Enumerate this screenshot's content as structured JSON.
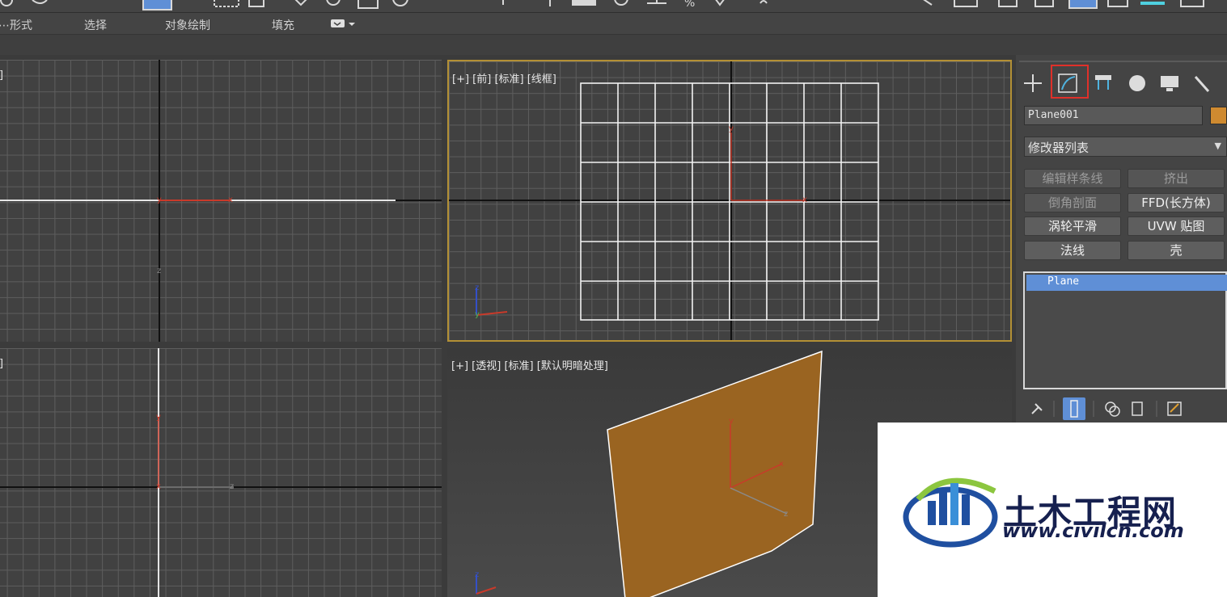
{
  "ribbon": {
    "items": [
      "多边形形式",
      "选择",
      "对象绘制",
      "填充"
    ],
    "shown": [
      "⋯形式",
      "选择",
      "对象绘制",
      "填充"
    ]
  },
  "viewports": {
    "top_left": {
      "label": "[+] [顶] [标准] [线框]",
      "visible_label": "]"
    },
    "top_right": {
      "label": "[+] [前] [标准] [线框]"
    },
    "bottom_left": {
      "label": "[+] [左] [标准] [线框]",
      "visible_label": "]"
    },
    "bottom_right": {
      "label": "[+] [透视] [标准] [默认明暗处理]"
    }
  },
  "panel": {
    "object_name": "Plane001",
    "object_color": "#cf8a30",
    "modifier_list": "修改器列表",
    "modifier_buttons": [
      "编辑样条线",
      "挤出",
      "倒角剖面",
      "FFD(长方体)",
      "涡轮平滑",
      "UVW 贴图",
      "法线",
      "壳"
    ],
    "stack": [
      "Plane"
    ],
    "tabs": [
      "create-icon",
      "modify-icon",
      "hierarchy-icon",
      "motion-icon",
      "display-icon",
      "utilities-icon"
    ],
    "active_tab": "modify-icon"
  },
  "watermark": {
    "name": "土木工程网",
    "url": "www.civilcn.com"
  },
  "axis_labels": {
    "x": "x",
    "y": "y",
    "z": "z"
  }
}
